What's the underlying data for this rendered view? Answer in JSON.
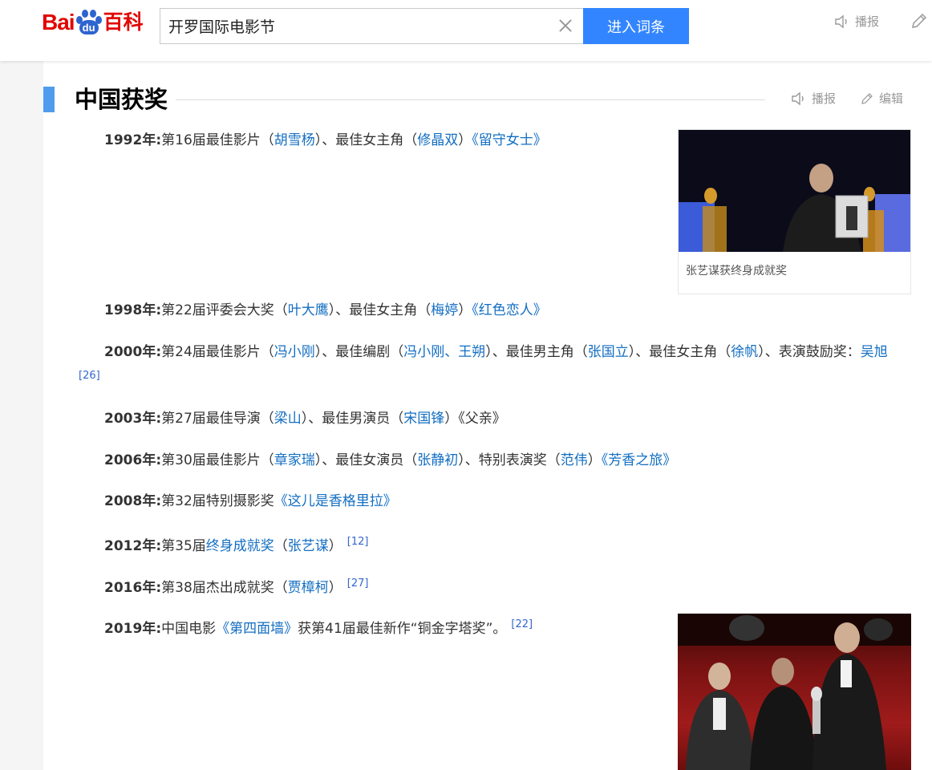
{
  "header": {
    "logo_bai": "Bai",
    "logo_du": "du",
    "logo_baike": "百科",
    "search_value": "开罗国际电影节",
    "search_button": "进入词条",
    "broadcast_label": "播报"
  },
  "section": {
    "title": "中国获奖",
    "broadcast_label": "播报",
    "edit_label": "编辑"
  },
  "figures": {
    "fig1_caption": "张艺谋获终身成就奖"
  },
  "awards": {
    "a1992": {
      "year": "1992年:",
      "t1": "第16届最佳影片（",
      "l1": "胡雪杨",
      "t2": "）、最佳女主角（",
      "l2": "修晶双",
      "t3": "）",
      "l3": "《留守女士》"
    },
    "a1998": {
      "year": "1998年:",
      "t1": "第22届评委会大奖（",
      "l1": "叶大鹰",
      "t2": "）、最佳女主角（",
      "l2": "梅婷",
      "t3": "）",
      "l3": "《红色恋人》"
    },
    "a2000": {
      "year": "2000年:",
      "t1": "第24届最佳影片（",
      "l1": "冯小刚",
      "t2": "）、最佳编剧（",
      "l2": "冯小刚",
      "t3": "、",
      "l3": "王朔",
      "t4": "）、最佳男主角（",
      "l4": "张国立",
      "t5": "）、最佳女主角（",
      "l5": "徐帆",
      "t6": "）、表演鼓励奖：",
      "l6": "吴旭",
      "ref": "[26]"
    },
    "a2003": {
      "year": "2003年:",
      "t1": "第27届最佳导演（",
      "l1": "梁山",
      "t2": "）、最佳男演员（",
      "l2": "宋国锋",
      "t3": "）《父亲》"
    },
    "a2006": {
      "year": "2006年:",
      "t1": "第30届最佳影片（",
      "l1": "章家瑞",
      "t2": "）、最佳女演员（",
      "l2": "张静初",
      "t3": "）、特别表演奖（",
      "l3": "范伟",
      "t4": "）",
      "l4": "《芳香之旅》"
    },
    "a2008": {
      "year": "2008年:",
      "t1": "第32届特别摄影奖",
      "l1": "《这儿是香格里拉》"
    },
    "a2012": {
      "year": "2012年:",
      "t1": "第35届",
      "l1": "终身成就奖",
      "t2": "（",
      "l2": "张艺谋",
      "t3": "）",
      "ref": "[12]"
    },
    "a2016": {
      "year": "2016年:",
      "t1": "第38届杰出成就奖（",
      "l1": "贾樟柯",
      "t2": "）",
      "ref": "[27]"
    },
    "a2019": {
      "year": "2019年:",
      "t1": "中国电影",
      "l1": "《第四面墙》",
      "t2": "获第41届最佳新作“铜金字塔奖”。",
      "ref": "[22]"
    }
  },
  "colors": {
    "accent": "#3385ff",
    "link": "#136ec2",
    "logo_red": "#e10602",
    "logo_blue": "#2e64ce",
    "section_bar": "#4f9cee"
  }
}
